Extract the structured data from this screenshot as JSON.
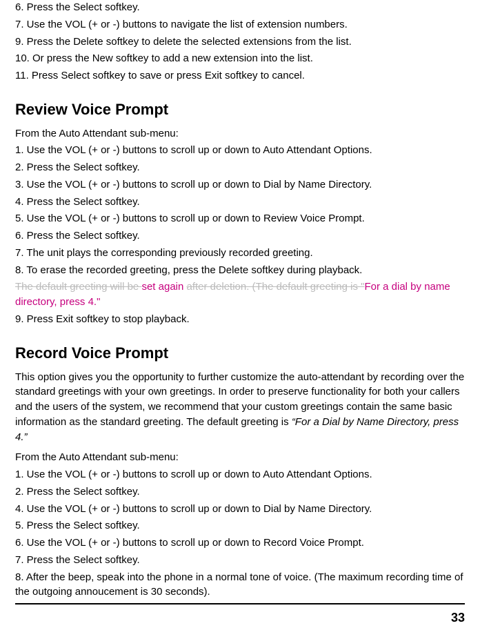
{
  "introLines": [
    "6. Press the Select softkey.",
    "7. Use the VOL (+ or -) buttons to navigate the list of extension numbers.",
    "9. Press the Delete softkey to delete the selected extensions from the list.",
    "10. Or press the New softkey to add a new extension into the list.",
    "11. Press Select softkey to save or press Exit softkey to cancel."
  ],
  "section1": {
    "heading": "Review Voice Prompt",
    "lines": [
      "From the Auto Attendant sub-menu:",
      "1. Use the VOL (+ or -) buttons to scroll up or down to Auto Attendant Options.",
      "2. Press the Select softkey.",
      "3. Use the VOL (+ or -) buttons to scroll up or down to Dial by Name Directory.",
      "4. Press the Select softkey.",
      "5. Use the VOL (+ or -) buttons to scroll up or down to Review Voice Prompt.",
      "6. Press the Select softkey.",
      "7. The unit plays the corresponding previously recorded greeting.",
      "8. To erase the recorded greeting, press the Delete softkey during playback."
    ],
    "mixed": {
      "strike1": "The default greeting will be ",
      "mag1": "set again ",
      "strike2": "after deletion. (",
      "strike3": "The default greeting is \"",
      "mag2": "For a dial by name directory, press 4.\""
    },
    "after": "9. Press Exit softkey to stop playback."
  },
  "section2": {
    "heading": "Record Voice Prompt",
    "paraPart1": "This option gives you the opportunity to further customize the auto-attendant by recording over the standard greetings with your own greetings.  In order to preserve functionality for both your callers and the users of the system, we recommend that your custom greetings contain the same basic information as the standard greeting.  The default greeting is ",
    "paraItalic": "“For a Dial by Name Directory, press 4.”",
    "lines": [
      "From the Auto Attendant sub-menu:",
      "1. Use the VOL (+ or -) buttons to scroll up or down to Auto Attendant Options.",
      "2. Press the Select softkey.",
      "4. Use the VOL (+ or -) buttons to scroll up or down to Dial by Name Directory.",
      "5. Press the Select softkey.",
      "6. Use the VOL (+ or -) buttons to scroll up or down to Record Voice Prompt.",
      "7. Press the Select softkey.",
      "8. After the beep, speak into the phone in a normal tone of voice. (The maximum recording time of the outgoing annoucement is 30 seconds)."
    ]
  },
  "pageNumber": "33"
}
